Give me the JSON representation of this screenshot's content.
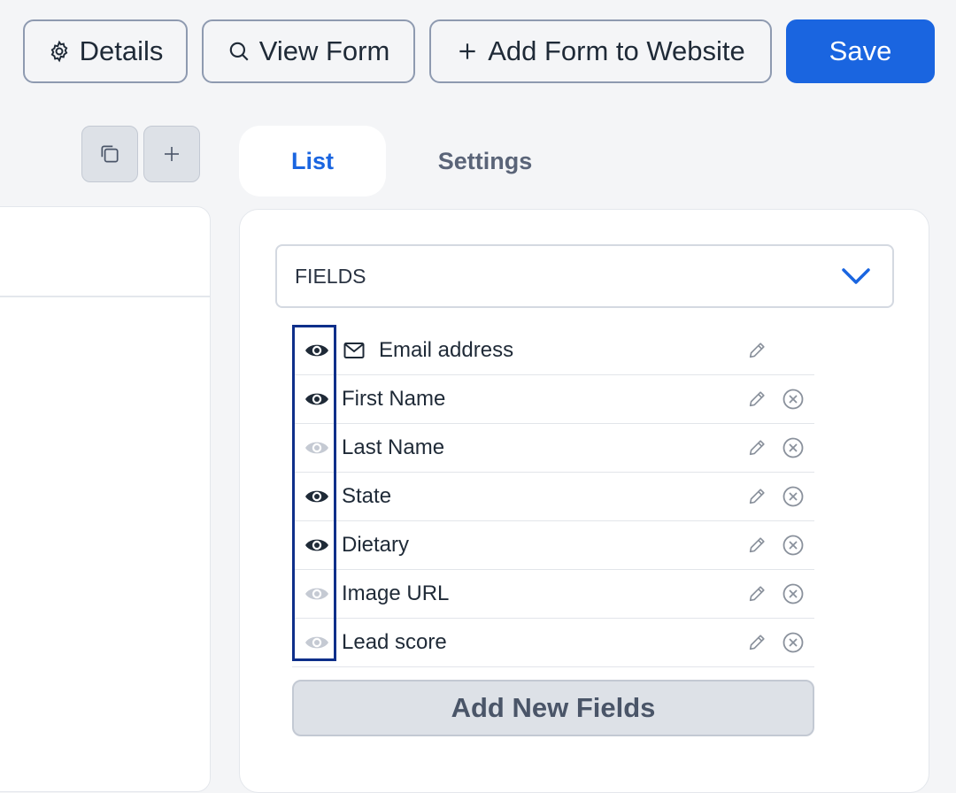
{
  "toolbar": {
    "details_label": "Details",
    "view_form_label": "View Form",
    "add_form_label": "Add Form to Website",
    "save_label": "Save"
  },
  "icons": {
    "details": "gear-icon",
    "view_form": "search-icon",
    "add_form": "plus-icon",
    "copy": "copy-icon",
    "add": "plus-icon"
  },
  "tabs": [
    {
      "label": "List",
      "active": true
    },
    {
      "label": "Settings",
      "active": false
    }
  ],
  "fields_dropdown": {
    "label": "FIELDS"
  },
  "fields": [
    {
      "label": "Email address",
      "visible": true,
      "icon": "mail-icon",
      "removable": false
    },
    {
      "label": "First Name",
      "visible": true,
      "removable": true
    },
    {
      "label": "Last Name",
      "visible": false,
      "removable": true
    },
    {
      "label": "State",
      "visible": true,
      "removable": true
    },
    {
      "label": "Dietary",
      "visible": true,
      "removable": true
    },
    {
      "label": "Image URL",
      "visible": false,
      "removable": true
    },
    {
      "label": "Lead score",
      "visible": false,
      "removable": true
    }
  ],
  "add_new_fields_label": "Add New Fields",
  "colors": {
    "accent": "#1a65e0",
    "eye_visible": "#1f2a37",
    "eye_hidden": "#c5cad3",
    "highlight_border": "#0e2f8a"
  }
}
